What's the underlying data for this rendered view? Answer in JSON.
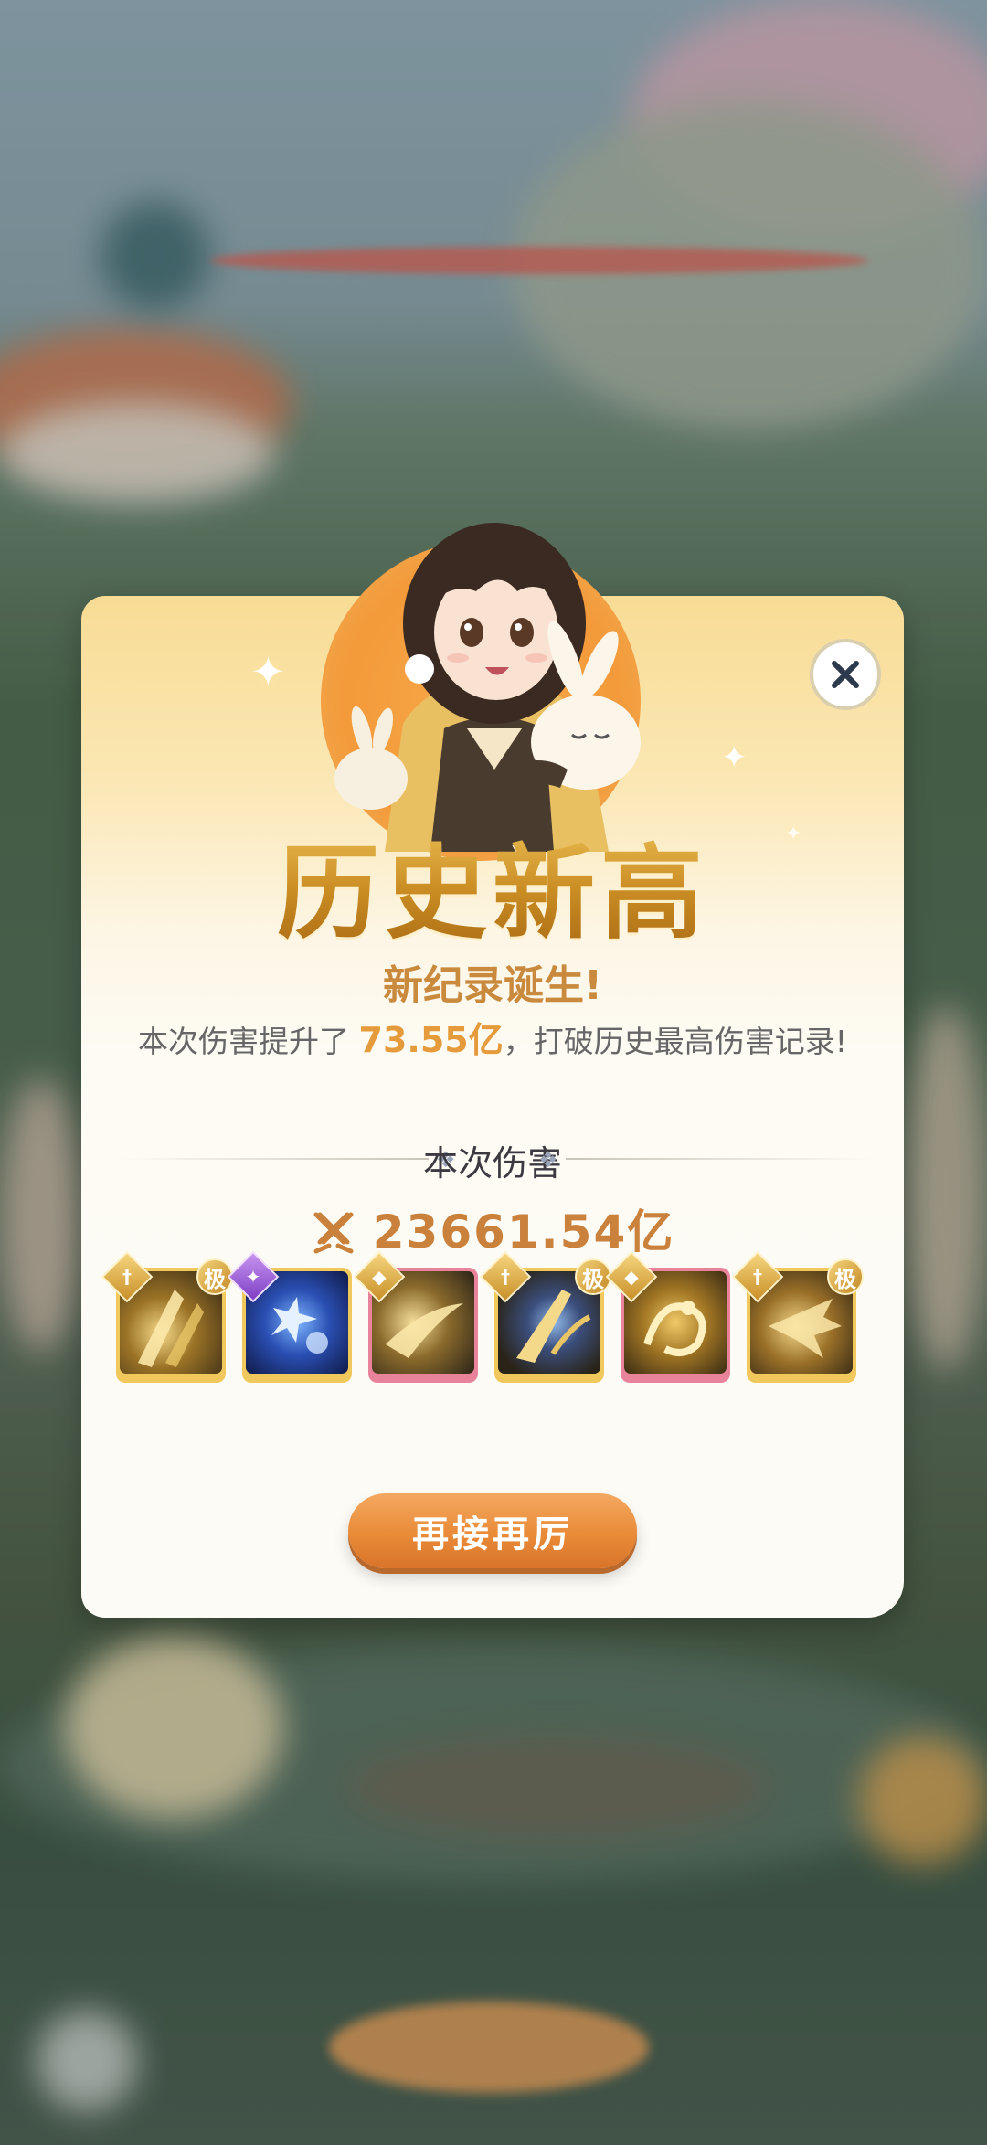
{
  "dialog": {
    "title": "历史新高",
    "subtitle": "新纪录诞生!",
    "desc_prefix": "本次伤害提升了 ",
    "desc_value": "73.55亿",
    "desc_suffix": "，打破历史最高伤害记录!",
    "section_title": "本次伤害",
    "damage_value": "23661.54亿",
    "retry_label": "再接再厉",
    "close_icon": "close-icon"
  },
  "skills": [
    {
      "badge": "sword",
      "tier": "极",
      "frame": "gold"
    },
    {
      "badge": "purple",
      "tier": "",
      "frame": "blue"
    },
    {
      "badge": "shield",
      "tier": "",
      "frame": "pink"
    },
    {
      "badge": "sword",
      "tier": "极",
      "frame": "gold"
    },
    {
      "badge": "shield",
      "tier": "",
      "frame": "pink"
    },
    {
      "badge": "sword",
      "tier": "极",
      "frame": "gold"
    }
  ],
  "colors": {
    "accent": "#e98b38",
    "title_gold": "#c98b22",
    "highlight": "#e59b3c"
  }
}
